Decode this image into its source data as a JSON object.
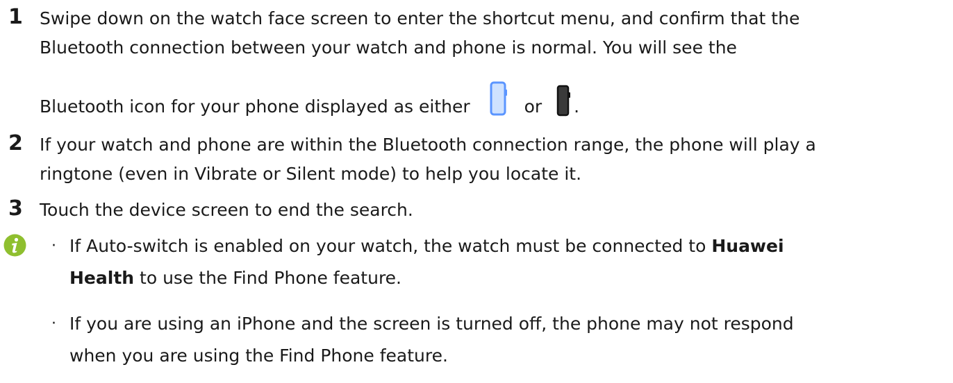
{
  "steps": [
    {
      "number": "1",
      "line1": "Swipe down on the watch face screen to enter the shortcut menu, and confirm that the",
      "line2": "Bluetooth connection between your watch and phone is normal. You will see the",
      "line3_prefix": "Bluetooth icon for your phone displayed as either",
      "line3_or": "or",
      "line3_suffix": "."
    },
    {
      "number": "2",
      "line1": "If your watch and phone are within the Bluetooth connection range, the phone will play a",
      "line2": "ringtone (even in Vibrate or Silent mode) to help you locate it."
    },
    {
      "number": "3",
      "line1": "Touch the device screen to end the search."
    }
  ],
  "notes": [
    {
      "bullet": "·",
      "line1_prefix": "If Auto-switch is enabled on your watch, the watch must be connected to",
      "line1_bold": "Huawei",
      "line2_bold": "Health",
      "line2_suffix": "to use the Find Phone feature."
    },
    {
      "bullet": "·",
      "line1": "If you are using an iPhone and the screen is turned off, the phone may not respond",
      "line2": "when you are using the Find Phone feature."
    }
  ],
  "icons": {
    "connected_phone": "phone-blue-icon",
    "disconnected_phone": "phone-black-icon",
    "note": "info-icon"
  },
  "colors": {
    "text": "#1a1a1a",
    "info_icon": "#8fbf2f",
    "phone_blue_fill": "#cfe2ff",
    "phone_blue_stroke": "#5b95ff",
    "phone_black_fill": "#3a3a3a"
  }
}
